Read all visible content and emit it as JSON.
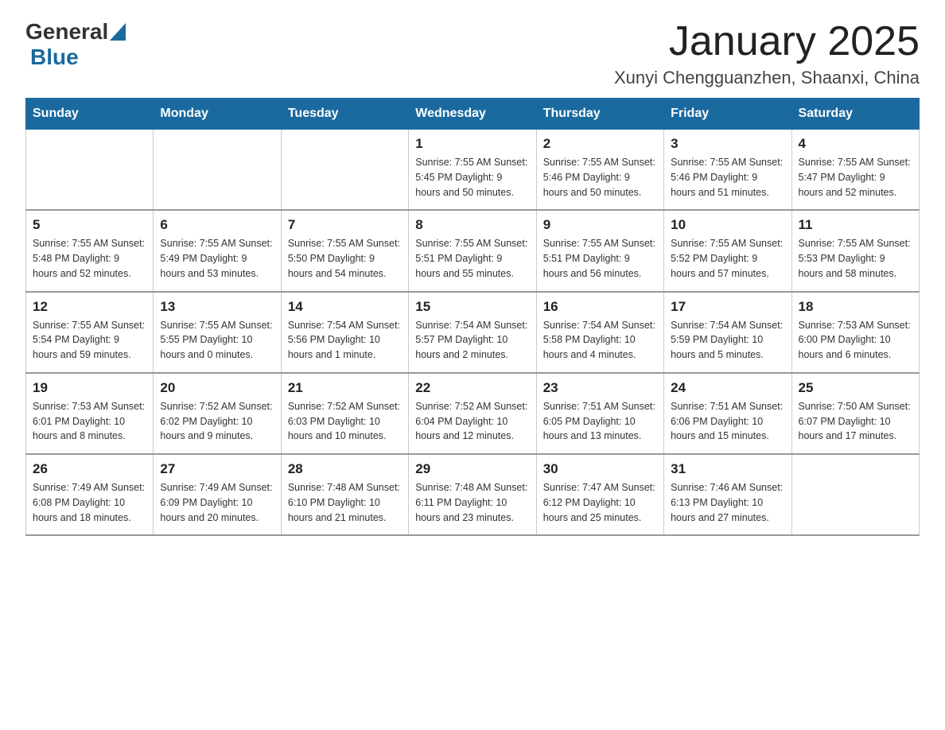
{
  "header": {
    "logo_general": "General",
    "logo_blue": "Blue",
    "title": "January 2025",
    "subtitle": "Xunyi Chengguanzhen, Shaanxi, China"
  },
  "days_of_week": [
    "Sunday",
    "Monday",
    "Tuesday",
    "Wednesday",
    "Thursday",
    "Friday",
    "Saturday"
  ],
  "weeks": [
    [
      {
        "day": "",
        "info": ""
      },
      {
        "day": "",
        "info": ""
      },
      {
        "day": "",
        "info": ""
      },
      {
        "day": "1",
        "info": "Sunrise: 7:55 AM\nSunset: 5:45 PM\nDaylight: 9 hours\nand 50 minutes."
      },
      {
        "day": "2",
        "info": "Sunrise: 7:55 AM\nSunset: 5:46 PM\nDaylight: 9 hours\nand 50 minutes."
      },
      {
        "day": "3",
        "info": "Sunrise: 7:55 AM\nSunset: 5:46 PM\nDaylight: 9 hours\nand 51 minutes."
      },
      {
        "day": "4",
        "info": "Sunrise: 7:55 AM\nSunset: 5:47 PM\nDaylight: 9 hours\nand 52 minutes."
      }
    ],
    [
      {
        "day": "5",
        "info": "Sunrise: 7:55 AM\nSunset: 5:48 PM\nDaylight: 9 hours\nand 52 minutes."
      },
      {
        "day": "6",
        "info": "Sunrise: 7:55 AM\nSunset: 5:49 PM\nDaylight: 9 hours\nand 53 minutes."
      },
      {
        "day": "7",
        "info": "Sunrise: 7:55 AM\nSunset: 5:50 PM\nDaylight: 9 hours\nand 54 minutes."
      },
      {
        "day": "8",
        "info": "Sunrise: 7:55 AM\nSunset: 5:51 PM\nDaylight: 9 hours\nand 55 minutes."
      },
      {
        "day": "9",
        "info": "Sunrise: 7:55 AM\nSunset: 5:51 PM\nDaylight: 9 hours\nand 56 minutes."
      },
      {
        "day": "10",
        "info": "Sunrise: 7:55 AM\nSunset: 5:52 PM\nDaylight: 9 hours\nand 57 minutes."
      },
      {
        "day": "11",
        "info": "Sunrise: 7:55 AM\nSunset: 5:53 PM\nDaylight: 9 hours\nand 58 minutes."
      }
    ],
    [
      {
        "day": "12",
        "info": "Sunrise: 7:55 AM\nSunset: 5:54 PM\nDaylight: 9 hours\nand 59 minutes."
      },
      {
        "day": "13",
        "info": "Sunrise: 7:55 AM\nSunset: 5:55 PM\nDaylight: 10 hours\nand 0 minutes."
      },
      {
        "day": "14",
        "info": "Sunrise: 7:54 AM\nSunset: 5:56 PM\nDaylight: 10 hours\nand 1 minute."
      },
      {
        "day": "15",
        "info": "Sunrise: 7:54 AM\nSunset: 5:57 PM\nDaylight: 10 hours\nand 2 minutes."
      },
      {
        "day": "16",
        "info": "Sunrise: 7:54 AM\nSunset: 5:58 PM\nDaylight: 10 hours\nand 4 minutes."
      },
      {
        "day": "17",
        "info": "Sunrise: 7:54 AM\nSunset: 5:59 PM\nDaylight: 10 hours\nand 5 minutes."
      },
      {
        "day": "18",
        "info": "Sunrise: 7:53 AM\nSunset: 6:00 PM\nDaylight: 10 hours\nand 6 minutes."
      }
    ],
    [
      {
        "day": "19",
        "info": "Sunrise: 7:53 AM\nSunset: 6:01 PM\nDaylight: 10 hours\nand 8 minutes."
      },
      {
        "day": "20",
        "info": "Sunrise: 7:52 AM\nSunset: 6:02 PM\nDaylight: 10 hours\nand 9 minutes."
      },
      {
        "day": "21",
        "info": "Sunrise: 7:52 AM\nSunset: 6:03 PM\nDaylight: 10 hours\nand 10 minutes."
      },
      {
        "day": "22",
        "info": "Sunrise: 7:52 AM\nSunset: 6:04 PM\nDaylight: 10 hours\nand 12 minutes."
      },
      {
        "day": "23",
        "info": "Sunrise: 7:51 AM\nSunset: 6:05 PM\nDaylight: 10 hours\nand 13 minutes."
      },
      {
        "day": "24",
        "info": "Sunrise: 7:51 AM\nSunset: 6:06 PM\nDaylight: 10 hours\nand 15 minutes."
      },
      {
        "day": "25",
        "info": "Sunrise: 7:50 AM\nSunset: 6:07 PM\nDaylight: 10 hours\nand 17 minutes."
      }
    ],
    [
      {
        "day": "26",
        "info": "Sunrise: 7:49 AM\nSunset: 6:08 PM\nDaylight: 10 hours\nand 18 minutes."
      },
      {
        "day": "27",
        "info": "Sunrise: 7:49 AM\nSunset: 6:09 PM\nDaylight: 10 hours\nand 20 minutes."
      },
      {
        "day": "28",
        "info": "Sunrise: 7:48 AM\nSunset: 6:10 PM\nDaylight: 10 hours\nand 21 minutes."
      },
      {
        "day": "29",
        "info": "Sunrise: 7:48 AM\nSunset: 6:11 PM\nDaylight: 10 hours\nand 23 minutes."
      },
      {
        "day": "30",
        "info": "Sunrise: 7:47 AM\nSunset: 6:12 PM\nDaylight: 10 hours\nand 25 minutes."
      },
      {
        "day": "31",
        "info": "Sunrise: 7:46 AM\nSunset: 6:13 PM\nDaylight: 10 hours\nand 27 minutes."
      },
      {
        "day": "",
        "info": ""
      }
    ]
  ]
}
